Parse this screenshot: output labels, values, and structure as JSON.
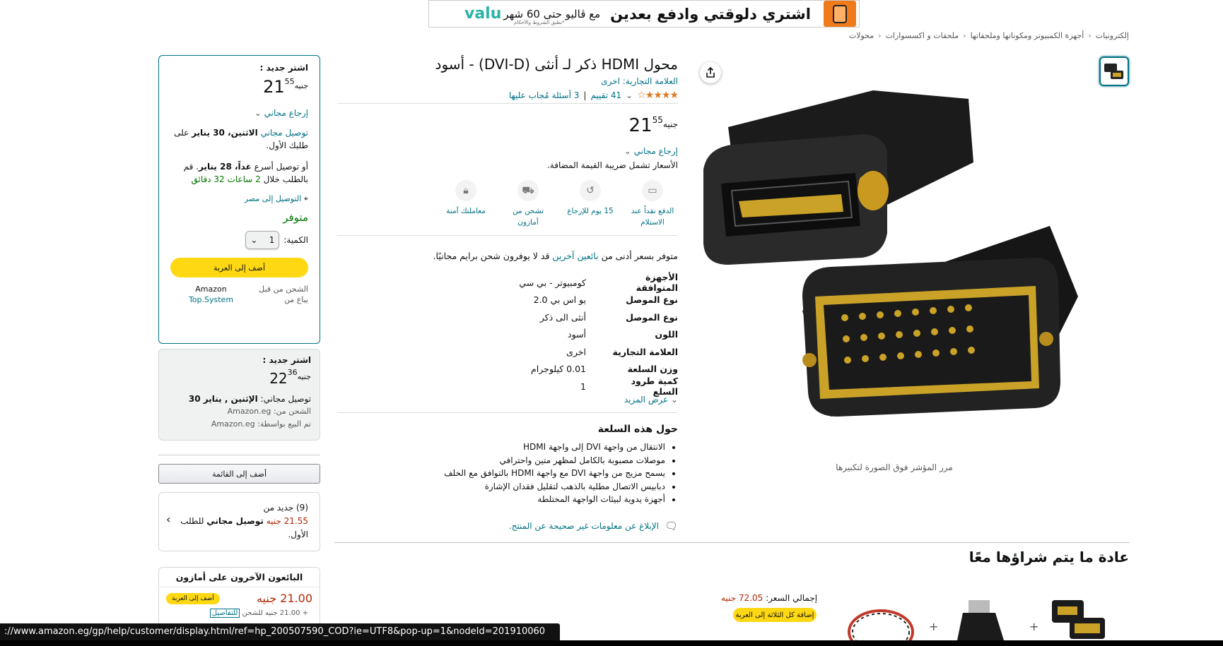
{
  "banner": {
    "headline": "اشتري دلوقتي وادفع بعدين",
    "sub": "مع ڤاليو حتى 60 شهر",
    "note": "*تطبق الشروط والأحكام",
    "brand": "valu"
  },
  "breadcrumb": [
    "إلكترونيات",
    "أجهزة الكمبيوتر ومكوناتها وملحقاتها",
    "ملحقات و اكسسوارات",
    "محولات"
  ],
  "product": {
    "title": "محول HDMI ذكر لـ أنثى (DVI-D) - أسود",
    "brand_line": "العلامة التجارية: اخرى",
    "stars": "★★★★☆",
    "ratings": "41 تقييم",
    "questions": "3 أسئلة مُجاب عليها",
    "price_whole": "21",
    "price_fraction": "55",
    "currency": "جنيه",
    "returns": "إرجاع مجاني",
    "vat": "الأسعار تشمل ضريبة القيمة المضافة.",
    "features": [
      {
        "icon": "cash-icon",
        "label": "الدفع نقداً عند الاستلام"
      },
      {
        "icon": "return-icon",
        "label": "15 يوم للإرجاع"
      },
      {
        "icon": "truck-icon",
        "label": "تشحن من أمازون"
      },
      {
        "icon": "lock-icon",
        "label": "معاملتك آمنة"
      }
    ],
    "cheaper_prefix": "متوفر بسعر أدنى من",
    "cheaper_link": "بائعين آخرين",
    "cheaper_suffix": "قد لا يوفرون شحن برايم مجانيًا.",
    "specs": [
      {
        "k": "الأجهزة المتوافقة",
        "v": "كومبيوتر - بي سي"
      },
      {
        "k": "نوع الموصل",
        "v": "يو اس بي 2.0"
      },
      {
        "k": "نوع الموصل",
        "v": "أنثى الى ذكر"
      },
      {
        "k": "اللون",
        "v": "أسود"
      },
      {
        "k": "العلامة التجارية",
        "v": "اخرى"
      },
      {
        "k": "وزن السلعة",
        "v": "0.01 كيلوجرام"
      },
      {
        "k": "كمية طرود السلع",
        "v": "1"
      }
    ],
    "see_more": "عرض المزيد",
    "about_title": "حول هذه السلعة",
    "bullets": [
      "الانتقال من واجهة DVI إلى واجهة HDMI",
      "موصلات مصبوبة بالكامل لمظهر متين واحترافي",
      "يسمح مزيج من واجهة DVI مع واجهة HDMI بالتوافق مع الخلف",
      "دبابيس الاتصال مطلية بالذهب لتقليل فقدان الإشارة",
      "أجهزة يدوية لبيئات الواجهة المختلطة"
    ],
    "report": "الإبلاغ عن معلومات غير صحيحة عن المنتج.",
    "image_caption": "مرر المؤشر فوق الصورة لتكبيرها"
  },
  "buybox": {
    "heading": "اشتر جديد :",
    "price_whole": "21",
    "price_fraction": "55",
    "currency": "جنيه",
    "returns": "إرجاع مجاني",
    "delivery_free": "توصيل مجاني",
    "delivery_date": "الاثنين، 30 يناير",
    "delivery_suffix": "على طلبك الأول.",
    "fast_prefix": "أو توصيل أسرع",
    "fast_date": "غداً، 28 يناير",
    "fast_order": ". قم بالطلب خلال",
    "fast_time": "2 ساعات 32 دقائق",
    "location": "التوصيل إلى مصر",
    "in_stock": "متوفر",
    "qty_label": "الكمية:",
    "qty_value": "1",
    "add_to_cart": "أضف إلى العربة",
    "ship_from_label": "الشحن من قبل",
    "ship_from": "Amazon",
    "sold_by_label": "يباع من",
    "sold_by": "Top.System"
  },
  "buybox2": {
    "heading": "اشتر جديد :",
    "price_whole": "22",
    "price_fraction": "36",
    "currency": "جنيه",
    "delivery_label": "توصيل مجاني:",
    "delivery_date": "الإثنين , يناير 30",
    "ship_label": "الشحن من:",
    "ship_value": "Amazon.eg",
    "sold_label": "تم البيع بواسطة:",
    "sold_value": "Amazon.eg"
  },
  "add_to_list": "أضف إلى القائمة",
  "new_offers": {
    "line1": "(9) جديد من",
    "price": "21.55",
    "currency": "جنيه",
    "free": "توصيل مجاني",
    "suffix": "للطلب الأول."
  },
  "other_sellers": {
    "title": "البائعون الآخرون على أمازون",
    "price": "21.00",
    "currency": "جنيه",
    "button": "أضف إلى العربة",
    "shipping": "+ 21.00 جنيه للشحن",
    "details": "للتفاصيل"
  },
  "fbt": {
    "title": "عادة ما يتم شراؤها معًا",
    "total_label": "إجمالي السعر:",
    "total_value": "72.05 جنيه",
    "button": "إضافة كل الثلاثة إلى العربة",
    "plus": "+"
  },
  "status_url": "://www.amazon.eg/gp/help/customer/display.html/ref=hp_200507590_COD?ie=UTF8&pop-up=1&nodeId=201910060",
  "colors": {
    "link": "#007185",
    "yellow": "#ffd814",
    "green": "#007600",
    "price_red": "#b12704",
    "star": "#de7921"
  }
}
